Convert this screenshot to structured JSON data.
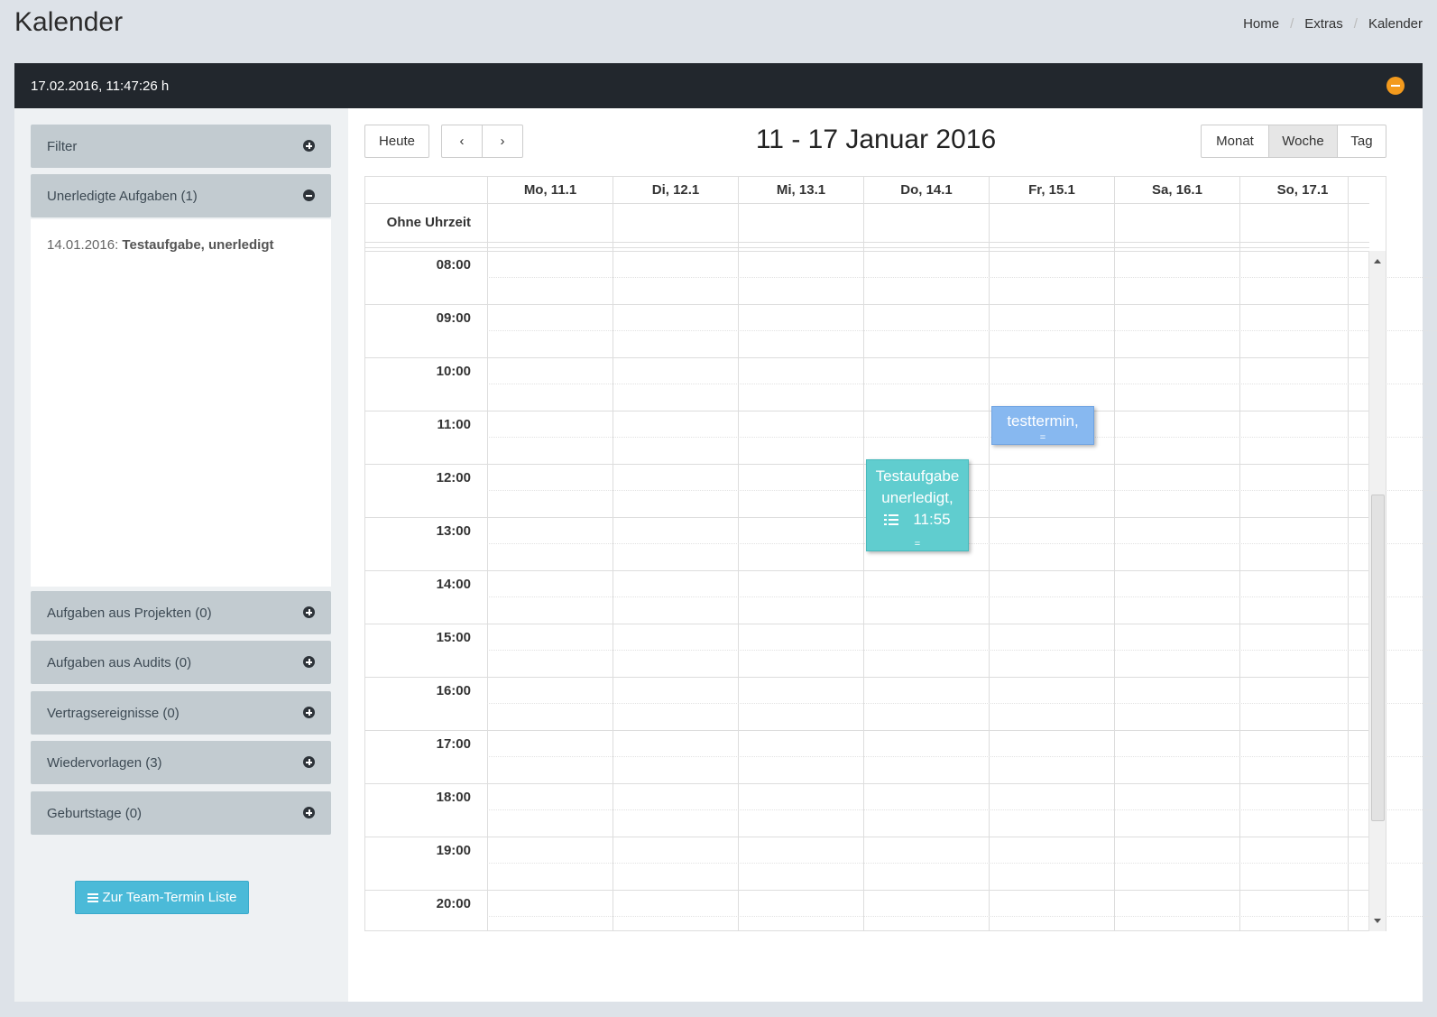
{
  "page": {
    "title": "Kalender"
  },
  "breadcrumb": {
    "items": [
      "Home",
      "Extras",
      "Kalender"
    ]
  },
  "panel": {
    "datetime": "17.02.2016, 11:47:26 h"
  },
  "sidebar": {
    "filter": "Filter",
    "open_section": "Unerledigte Aufgaben (1)",
    "open_items": [
      {
        "date": "14.01.2016:",
        "title": "Testaufgabe, unerledigt"
      }
    ],
    "sections": [
      "Aufgaben aus Projekten (0)",
      "Aufgaben aus Audits (0)",
      "Vertragsereignisse (0)",
      "Wiedervorlagen (3)",
      "Geburtstage (0)"
    ],
    "team_button": "Zur Team-Termin Liste"
  },
  "calendar": {
    "today": "Heute",
    "prev": "‹",
    "next": "›",
    "title": "11 - 17 Januar 2016",
    "views": [
      "Monat",
      "Woche",
      "Tag"
    ],
    "active_view": "Woche",
    "days": [
      "Mo, 11.1",
      "Di, 12.1",
      "Mi, 13.1",
      "Do, 14.1",
      "Fr, 15.1",
      "Sa, 16.1",
      "So, 17.1"
    ],
    "allday_label": "Ohne Uhrzeit",
    "times": [
      "08:00",
      "09:00",
      "10:00",
      "11:00",
      "12:00",
      "13:00",
      "14:00",
      "15:00",
      "16:00",
      "17:00",
      "18:00",
      "19:00",
      "20:00"
    ],
    "events": [
      {
        "text": "testtermin,",
        "color": "#87b8f0"
      },
      {
        "line1": "Testaufgabe",
        "line2": "unerledigt,",
        "time": "11:55",
        "color": "#60cdcf"
      }
    ]
  },
  "colors": {
    "header": "#22272d",
    "accent": "#f39a1d",
    "button": "#4bbad8",
    "accordion": "#c2cbd0"
  }
}
